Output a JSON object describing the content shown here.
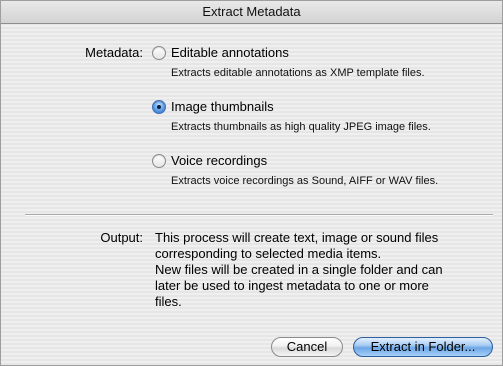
{
  "window": {
    "title": "Extract Metadata"
  },
  "metadata": {
    "label": "Metadata:",
    "options": [
      {
        "label": "Editable annotations",
        "description": "Extracts editable annotations as XMP template files.",
        "selected": false
      },
      {
        "label": "Image thumbnails",
        "description": "Extracts thumbnails as high quality JPEG image files.",
        "selected": true
      },
      {
        "label": "Voice recordings",
        "description": "Extracts voice recordings as Sound, AIFF or WAV files.",
        "selected": false
      }
    ]
  },
  "output": {
    "label": "Output:",
    "lines": [
      "This process will create text, image or sound files",
      "corresponding to selected media items.",
      "New files will be created in a single folder and can",
      "later be used to ingest metadata to one or more",
      "files."
    ]
  },
  "buttons": {
    "cancel": "Cancel",
    "extract": "Extract in Folder..."
  },
  "colors": {
    "default_button": "#6da6e6",
    "radio_selected": "#2b6bc4"
  }
}
